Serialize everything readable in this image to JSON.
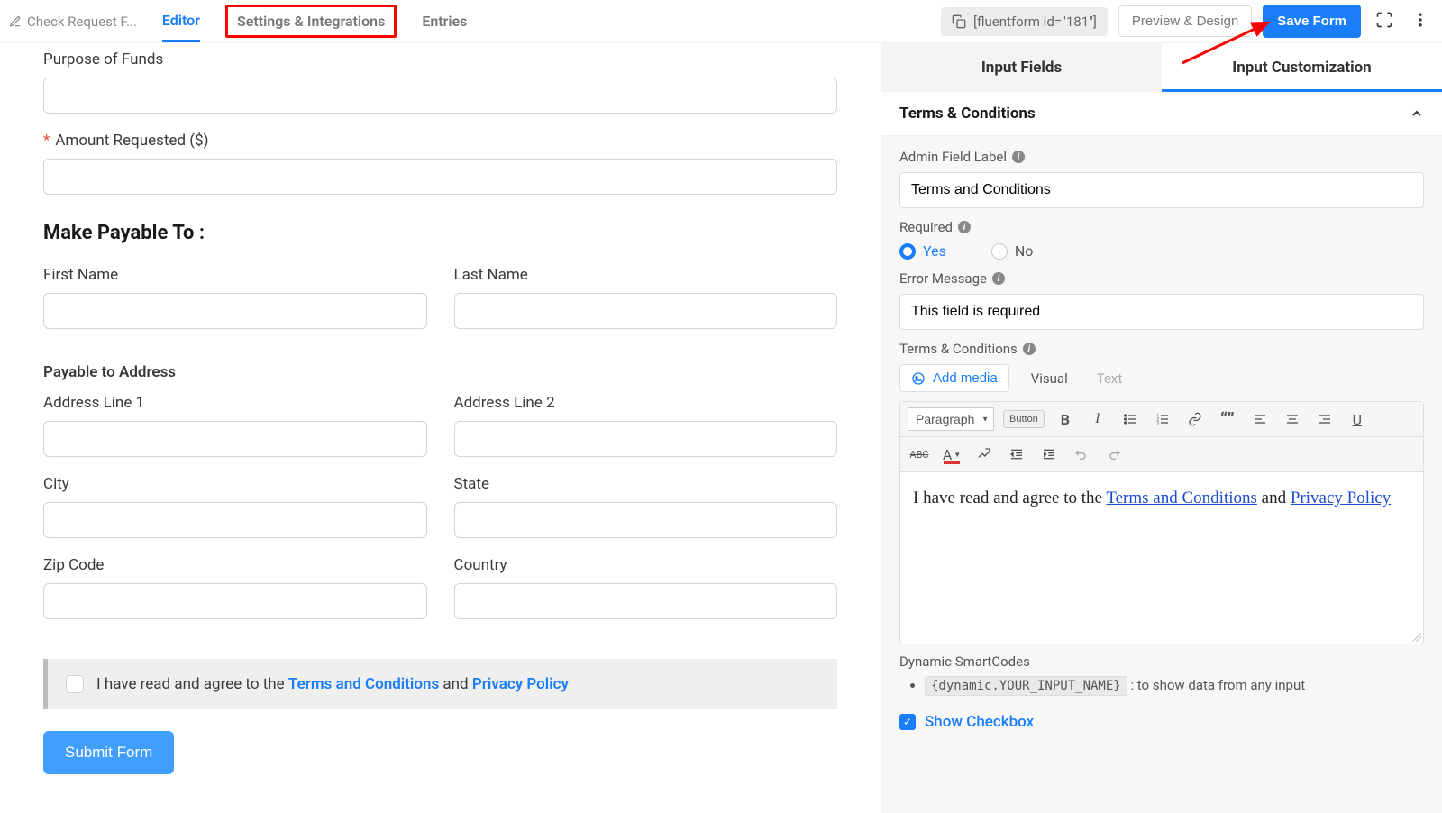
{
  "header": {
    "form_name": "Check Request F...",
    "tabs": {
      "editor": "Editor",
      "settings": "Settings & Integrations",
      "entries": "Entries"
    },
    "shortcode": "[fluentform id=\"181\"]",
    "preview_btn": "Preview & Design",
    "save_btn": "Save Form"
  },
  "form": {
    "purpose_label": "Purpose of Funds",
    "amount_label": "Amount Requested ($)",
    "section_title": "Make Payable To :",
    "first_name": "First Name",
    "last_name": "Last Name",
    "payable_address": "Payable to Address",
    "addr1": "Address Line 1",
    "addr2": "Address Line 2",
    "city": "City",
    "state": "State",
    "zip": "Zip Code",
    "country": "Country",
    "tc_pre": "I have read and agree to the ",
    "tc_link1": "Terms and Conditions",
    "tc_mid": " and ",
    "tc_link2": "Privacy Policy",
    "submit": "Submit Form"
  },
  "panel": {
    "tab_fields": "Input Fields",
    "tab_custom": "Input Customization",
    "accordion_title": "Terms & Conditions",
    "admin_label": "Admin Field Label",
    "admin_value": "Terms and Conditions",
    "required_label": "Required",
    "yes": "Yes",
    "no": "No",
    "error_label": "Error Message",
    "error_value": "This field is required",
    "tc_label": "Terms & Conditions",
    "add_media": "Add media",
    "visual": "Visual",
    "text_tab": "Text",
    "format_select": "Paragraph",
    "button_btn": "Button",
    "editor_pre": "I have read and agree to the ",
    "editor_link1": "Terms and Conditions",
    "editor_mid": " and ",
    "editor_link2": "Privacy Policy",
    "smartcodes_label": "Dynamic SmartCodes",
    "smartcode_code": "{dynamic.YOUR_INPUT_NAME}",
    "smartcode_desc": " : to show data from any input",
    "show_checkbox": "Show Checkbox"
  }
}
